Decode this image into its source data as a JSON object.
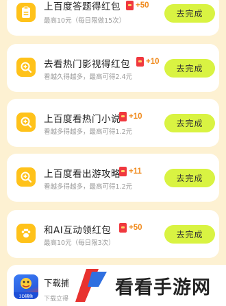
{
  "tasks": [
    {
      "title": "上百度答题得红包",
      "reward": "+50",
      "subtitle": "最高10元（每日限做15次）",
      "button": "去完成",
      "icon": "clipboard-icon"
    },
    {
      "title": "去看热门影视得红包",
      "reward": "+10",
      "subtitle": "看越久得越多，最高可得2.4元",
      "button": "去完成",
      "icon": "search-plus-icon"
    },
    {
      "title": "上百度看热门小说",
      "reward": "+10",
      "subtitle": "看越多得越多，最高可得1.2元",
      "button": "去完成",
      "icon": "search-plus-icon"
    },
    {
      "title": "上百度看出游攻略",
      "reward": "+11",
      "subtitle": "看越多得越多，最高可得1.2元",
      "button": "去完成",
      "icon": "search-plus-icon"
    },
    {
      "title": "和AI互动领红包",
      "reward": "+50",
      "subtitle": "最高10元（每日限3次）",
      "button": "去完成",
      "icon": "paw-icon"
    }
  ],
  "bottom": {
    "title": "下载捕",
    "subtitle": "下载立得",
    "logo_badge": "3D捕鱼"
  },
  "watermark": {
    "text": "看看手游网"
  },
  "colors": {
    "background": "#fdf1d2",
    "icon": "#ffc21a",
    "button": "#d9f342",
    "reward": "#f08a1c",
    "red_packet": "#f0383e"
  }
}
